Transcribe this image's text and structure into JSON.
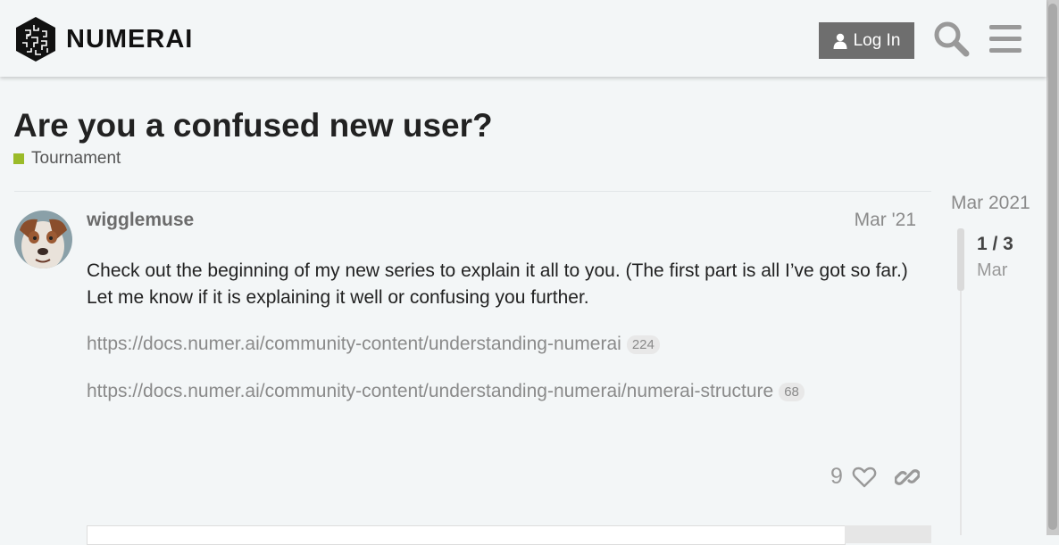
{
  "header": {
    "logo_text": "NUMERAI",
    "login_label": "Log In",
    "icons": [
      "user-icon",
      "search-icon",
      "hamburger-menu-icon"
    ]
  },
  "topic": {
    "title": "Are you a confused new user?",
    "category": "Tournament",
    "category_color": "#9bbb29"
  },
  "post": {
    "username": "wigglemuse",
    "date": "Mar '21",
    "body": "Check out the beginning of my new series to explain it all to you. (The first part is all I’ve got so far.) Let me know if it is explaining it well or confusing you further.",
    "links": [
      {
        "url": "https://docs.numer.ai/community-content/understanding-numerai",
        "clicks": "224"
      },
      {
        "url": "https://docs.numer.ai/community-content/understanding-numerai/numerai-structure",
        "clicks": "68"
      }
    ],
    "like_count": "9",
    "icons": [
      "heart-icon",
      "link-icon"
    ]
  },
  "timeline": {
    "top_date": "Mar 2021",
    "position": "1 / 3",
    "current_date": "Mar"
  },
  "colors": {
    "background": "#f3f6f7",
    "login_button": "#6e6e6e",
    "muted_text": "#8a8a8a"
  }
}
